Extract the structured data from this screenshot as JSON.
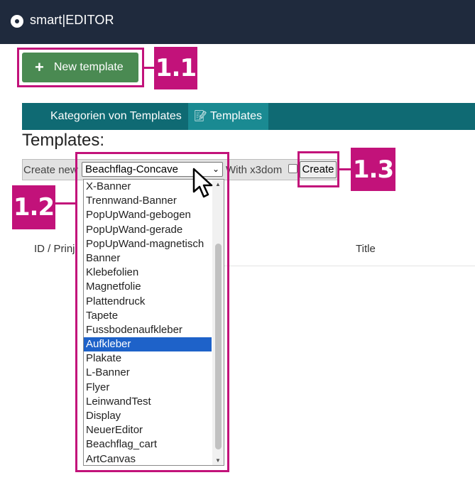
{
  "header": {
    "brand": "smart|EDITOR"
  },
  "toolbar": {
    "new_template_label": "New template"
  },
  "nav": {
    "tabs": [
      {
        "label": "Kategorien von Templates"
      },
      {
        "label": "Templates"
      }
    ]
  },
  "page": {
    "heading": "Templates:"
  },
  "form": {
    "create_new_label": "Create new",
    "selected_value": "Beachflag-Concave",
    "with_x3dom_label": "With x3dom",
    "create_label": "Create"
  },
  "table": {
    "columns": [
      "ID / Prinj",
      "Title"
    ]
  },
  "dropdown": {
    "selected_index": 11,
    "options": [
      "X-Banner",
      "Trennwand-Banner",
      "PopUpWand-gebogen",
      "PopUpWand-gerade",
      "PopUpWand-magnetisch",
      "Banner",
      "Klebefolien",
      "Magnetfolie",
      "Plattendruck",
      "Tapete",
      "Fussbodenaufkleber",
      "Aufkleber",
      "Plakate",
      "L-Banner",
      "Flyer",
      "LeinwandTest",
      "Display",
      "NeuerEditor",
      "Beachflag_cart",
      "ArtCanvas"
    ]
  },
  "callouts": {
    "c1": "1.1",
    "c2": "1.2",
    "c3": "1.3",
    "color": "#c2127a"
  }
}
